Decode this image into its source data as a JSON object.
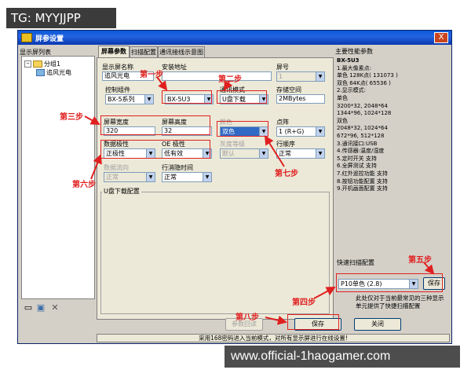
{
  "watermark_top": "TG: MYYJJPP",
  "watermark_bottom": "www.official-1haogamer.com",
  "window": {
    "title": "屏参设置",
    "close": "X"
  },
  "left_panel": {
    "label": "显示屏列表",
    "tree": [
      {
        "text": "分组1",
        "toggle": "−"
      },
      {
        "text": "追风光电"
      }
    ],
    "icons": [
      "folder-icon",
      "screen-icon",
      "delete-icon"
    ]
  },
  "tabs": [
    "屏幕参数",
    "扫描配置",
    "通讯接线示意图"
  ],
  "form": {
    "screen_name_label": "显示屏名称",
    "screen_name_value": "追风光电",
    "install_location_label": "安装地址",
    "install_location_value": "",
    "screen_no_label": "屏号",
    "screen_no_value": "1",
    "controller_label": "控制组件",
    "controller_series": "BX-5系列",
    "controller_model": "BX-5U3",
    "comm_mode_label": "通讯模式",
    "comm_mode_value": "U盘下载",
    "storage_label": "存储空间",
    "storage_value": "2MBytes",
    "width_label": "屏幕宽度",
    "width_value": "320",
    "height_label": "屏幕高度",
    "height_value": "32",
    "color_label": "颜色",
    "color_value": "双色",
    "pixel_label": "点阵",
    "pixel_value": "1 (R+G)",
    "gray_label": "灰度等级",
    "gray_value": "默认",
    "data_polarity_label": "数据极性",
    "data_polarity_value": "正极性",
    "oe_polarity_label": "OE 极性",
    "oe_polarity_value": "低有效",
    "row_order_label": "行顺序",
    "row_order_value": "正常",
    "data_flow_label": "数据流向",
    "data_flow_value": "正常",
    "row_hide_label": "行消隐时间",
    "row_hide_value": "正常",
    "usb_group_label": "U盘下载配置"
  },
  "right_panel": {
    "title": "主要性能参数",
    "lines": [
      "BX-5U3",
      "1.最大像素点:",
      "  单色 128K点( 131073 )",
      "  双色 64K点( 65536 )",
      "2.显示模式:",
      "  单色",
      "  3200*32, 2048*64",
      "  1344*96, 1024*128",
      "  双色",
      "  2048*32, 1024*64",
      "  672*96, 512*128",
      "3.通讯接口:USB",
      "4.传感器:温度/湿度",
      "5.定时开关 支持",
      "6.全屏测试 支持",
      "7.红外遥控功能 支持",
      "8.按钮功能配置 支持",
      "9.开机画面配置 支持"
    ],
    "quick_scan_label": "快速扫描配置",
    "quick_scan_value": "P10单色 (2.8)",
    "save_small": "保存",
    "note": "此处仅对于当前最常见的三种显示单元提供了快捷扫描配置"
  },
  "buttons": {
    "preset": "参数回读",
    "save": "保存",
    "close": "关闭"
  },
  "status_bar": "采用168密码进入当前模式，对所有显示屏进行在线设置!",
  "annotations": {
    "step1": "第一步",
    "step2": "第二步",
    "step3": "第三步",
    "step4": "第四步",
    "step5": "第五步",
    "step6": "第六步",
    "step7": "第七步",
    "step8": "第八步"
  },
  "colors": {
    "annotation": "#e02020",
    "titlebar": "#0a5ad8",
    "panel": "#ece9d8"
  }
}
